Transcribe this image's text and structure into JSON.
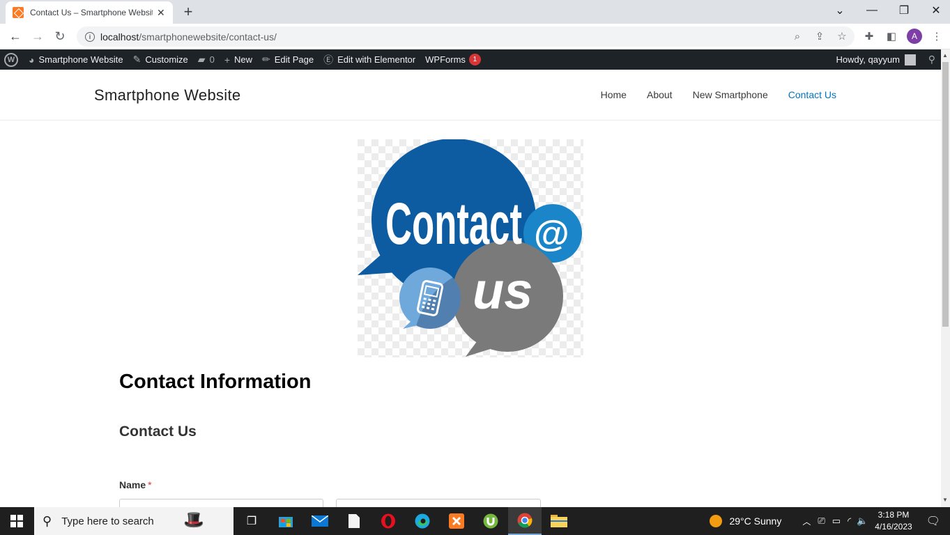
{
  "browser": {
    "tab_title": "Contact Us – Smartphone Website",
    "url_host": "localhost",
    "url_path": "/smartphonewebsite/contact-us/",
    "profile_initial": "A"
  },
  "adminbar": {
    "site_name": "Smartphone Website",
    "customize": "Customize",
    "comments_count": "0",
    "new": "New",
    "edit_page": "Edit Page",
    "edit_elementor": "Edit with Elementor",
    "wpforms": "WPForms",
    "wpforms_badge": "1",
    "howdy": "Howdy, qayyum"
  },
  "site": {
    "title": "Smartphone Website",
    "nav": [
      "Home",
      "About",
      "New Smartphone",
      "Contact Us"
    ],
    "current_nav": "Contact Us"
  },
  "content": {
    "image_word1": "Contact",
    "image_word2": "us",
    "image_at": "@",
    "heading": "Contact Information",
    "form_title": "Contact Us",
    "name_label": "Name",
    "required_mark": "*"
  },
  "taskbar": {
    "search_placeholder": "Type here to search",
    "weather": "29°C  Sunny",
    "time": "3:18 PM",
    "date": "4/16/2023"
  },
  "colors": {
    "accent_link": "#0274be",
    "admin_bar": "#1d2327",
    "bubble_dark_blue": "#0d5ca1",
    "bubble_gray": "#7a7a7a"
  }
}
